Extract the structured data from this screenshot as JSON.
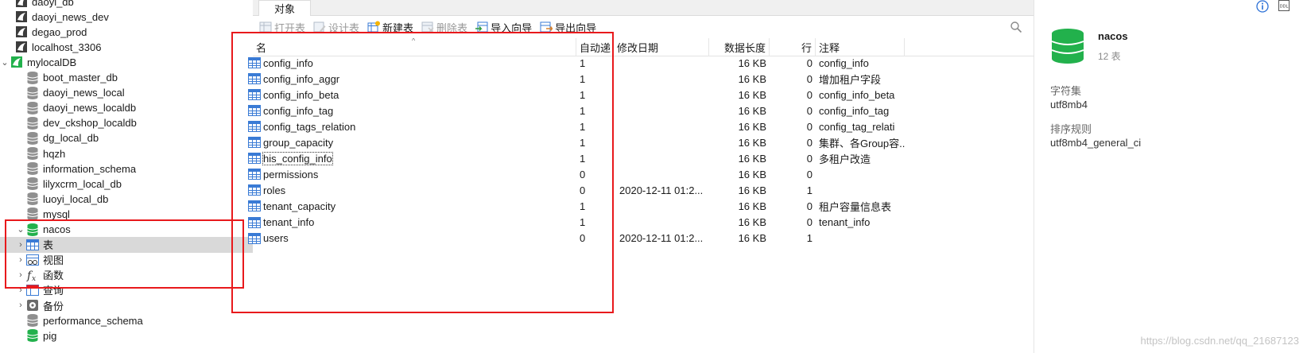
{
  "nav": {
    "items": [
      {
        "label": "daoyi_db",
        "kind": "connection",
        "expand": ""
      },
      {
        "label": "daoyi_news_dev",
        "kind": "connection",
        "expand": ""
      },
      {
        "label": "degao_prod",
        "kind": "connection",
        "expand": ""
      },
      {
        "label": "localhost_3306",
        "kind": "connection",
        "expand": ""
      },
      {
        "label": "mylocalDB",
        "kind": "connection-open",
        "expand": "⌄"
      },
      {
        "label": "boot_master_db",
        "kind": "database",
        "expand": ""
      },
      {
        "label": "daoyi_news_local",
        "kind": "database",
        "expand": ""
      },
      {
        "label": "daoyi_news_localdb",
        "kind": "database",
        "expand": ""
      },
      {
        "label": "dev_ckshop_localdb",
        "kind": "database",
        "expand": ""
      },
      {
        "label": "dg_local_db",
        "kind": "database",
        "expand": ""
      },
      {
        "label": "hqzh",
        "kind": "database",
        "expand": ""
      },
      {
        "label": "information_schema",
        "kind": "database",
        "expand": ""
      },
      {
        "label": "lilyxcrm_local_db",
        "kind": "database",
        "expand": ""
      },
      {
        "label": "luoyi_local_db",
        "kind": "database",
        "expand": ""
      },
      {
        "label": "mysql",
        "kind": "database",
        "expand": ""
      },
      {
        "label": "nacos",
        "kind": "database-open",
        "expand": "⌄"
      },
      {
        "label": "表",
        "kind": "tables",
        "expand": "›"
      },
      {
        "label": "视图",
        "kind": "views",
        "expand": "›"
      },
      {
        "label": "函数",
        "kind": "functions",
        "expand": "›"
      },
      {
        "label": "查询",
        "kind": "queries",
        "expand": "›"
      },
      {
        "label": "备份",
        "kind": "backups",
        "expand": "›"
      },
      {
        "label": "performance_schema",
        "kind": "database",
        "expand": ""
      },
      {
        "label": "pig",
        "kind": "database-open",
        "expand": ""
      }
    ]
  },
  "tabs": {
    "objects": "对象"
  },
  "toolbar": {
    "open_table": "打开表",
    "design_table": "设计表",
    "new_table": "新建表",
    "delete_table": "删除表",
    "import_wizard": "导入向导",
    "export_wizard": "导出向导"
  },
  "table": {
    "sort_indicator": "^",
    "headers": {
      "name": "名",
      "auto_increment": "自动递",
      "modified": "修改日期",
      "data_length": "数据长度",
      "rows": "行",
      "comment": "注释"
    },
    "rows": [
      {
        "name": "config_info",
        "auto": "1",
        "modified": "",
        "size": "16 KB",
        "rows": "0",
        "comment": "config_info"
      },
      {
        "name": "config_info_aggr",
        "auto": "1",
        "modified": "",
        "size": "16 KB",
        "rows": "0",
        "comment": "增加租户字段"
      },
      {
        "name": "config_info_beta",
        "auto": "1",
        "modified": "",
        "size": "16 KB",
        "rows": "0",
        "comment": "config_info_beta"
      },
      {
        "name": "config_info_tag",
        "auto": "1",
        "modified": "",
        "size": "16 KB",
        "rows": "0",
        "comment": "config_info_tag"
      },
      {
        "name": "config_tags_relation",
        "auto": "1",
        "modified": "",
        "size": "16 KB",
        "rows": "0",
        "comment": "config_tag_relati"
      },
      {
        "name": "group_capacity",
        "auto": "1",
        "modified": "",
        "size": "16 KB",
        "rows": "0",
        "comment": "集群、各Group容..."
      },
      {
        "name": "his_config_info",
        "auto": "1",
        "modified": "",
        "size": "16 KB",
        "rows": "0",
        "comment": "多租户改造"
      },
      {
        "name": "permissions",
        "auto": "0",
        "modified": "",
        "size": "16 KB",
        "rows": "0",
        "comment": ""
      },
      {
        "name": "roles",
        "auto": "0",
        "modified": "2020-12-11 01:2...",
        "size": "16 KB",
        "rows": "1",
        "comment": ""
      },
      {
        "name": "tenant_capacity",
        "auto": "1",
        "modified": "",
        "size": "16 KB",
        "rows": "0",
        "comment": "租户容量信息表"
      },
      {
        "name": "tenant_info",
        "auto": "1",
        "modified": "",
        "size": "16 KB",
        "rows": "0",
        "comment": "tenant_info"
      },
      {
        "name": "users",
        "auto": "0",
        "modified": "2020-12-11 01:2...",
        "size": "16 KB",
        "rows": "1",
        "comment": ""
      }
    ]
  },
  "info": {
    "name": "nacos",
    "count": "12 表",
    "charset_label": "字符集",
    "charset_value": "utf8mb4",
    "collation_label": "排序规则",
    "collation_value": "utf8mb4_general_ci",
    "ddl_icon_text": "DDL"
  },
  "watermark": "https://blog.csdn.net/qq_21687123",
  "colors": {
    "annotation_red": "#e8191c",
    "db_green": "#22b14c",
    "table_icon_blue": "#3a7bd5",
    "selected_row": "#d9d9d9"
  }
}
